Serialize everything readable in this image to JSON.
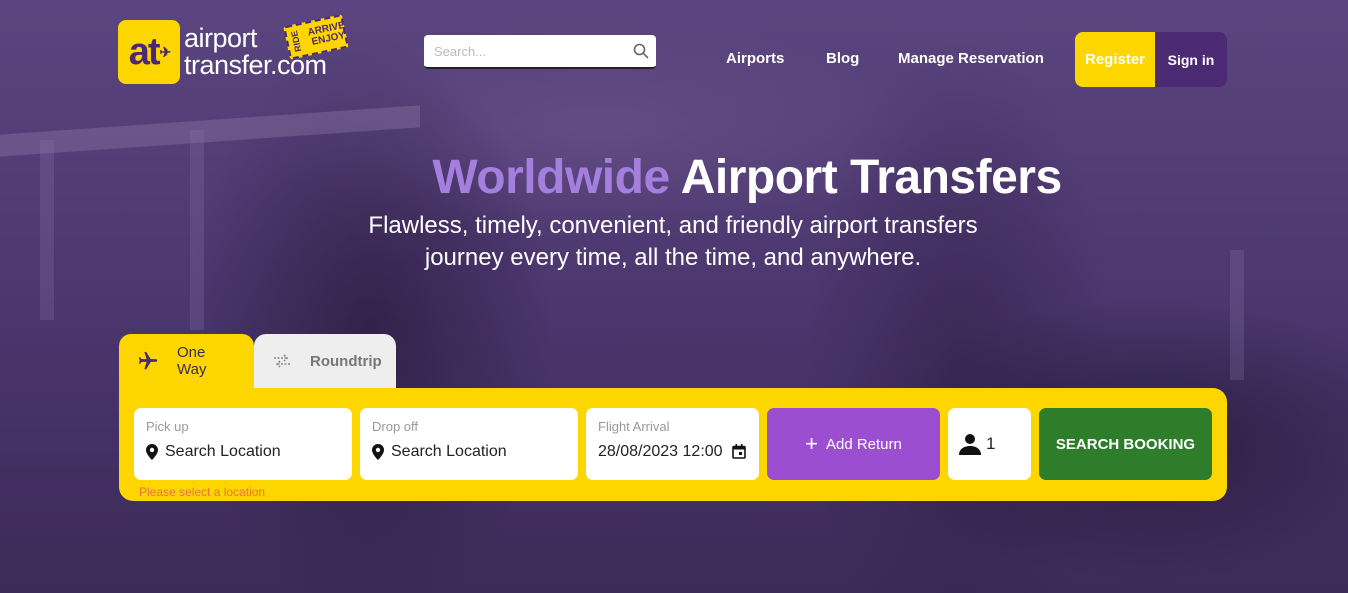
{
  "header": {
    "logo": {
      "mark": "at",
      "line1": "airport",
      "line2": "transfer.com",
      "badge_ride": "RIDE",
      "badge_arrive": "ARRIVE",
      "badge_enjoy": "ENJOY"
    },
    "search": {
      "placeholder": "Search..."
    },
    "nav": [
      "Airports",
      "Blog",
      "Manage Reservation"
    ],
    "register_label": "Register",
    "signin_label": "Sign in"
  },
  "hero": {
    "title_accent": "Worldwide",
    "title_rest": "Airport Transfers",
    "subtitle_line1": "Flawless, timely, convenient, and friendly airport transfers",
    "subtitle_line2": "journey every time, all the time, and anywhere."
  },
  "booking": {
    "tabs": [
      {
        "label": "One Way",
        "icon": "airplane-icon",
        "active": true
      },
      {
        "label": "Roundtrip",
        "icon": "swap-arrows-icon",
        "active": false
      }
    ],
    "pickup": {
      "label": "Pick up",
      "value": "Search Location",
      "icon": "location-pin-icon"
    },
    "dropoff": {
      "label": "Drop off",
      "value": "Search Location",
      "icon": "location-pin-icon"
    },
    "flight_arrival": {
      "label": "Flight Arrival",
      "value": "28/08/2023 12:00",
      "icon": "calendar-icon"
    },
    "add_return_label": "Add Return",
    "passengers": {
      "value": "1",
      "icon": "person-icon"
    },
    "search_label": "SEARCH BOOKING",
    "error": "Please select a location"
  },
  "colors": {
    "brand_yellow": "#fdd600",
    "brand_purple": "#4b2a73",
    "accent_purple": "#a57fdd",
    "return_purple": "#9c4ed1",
    "search_green": "#2d7d2a",
    "error_orange": "#e8743b"
  }
}
